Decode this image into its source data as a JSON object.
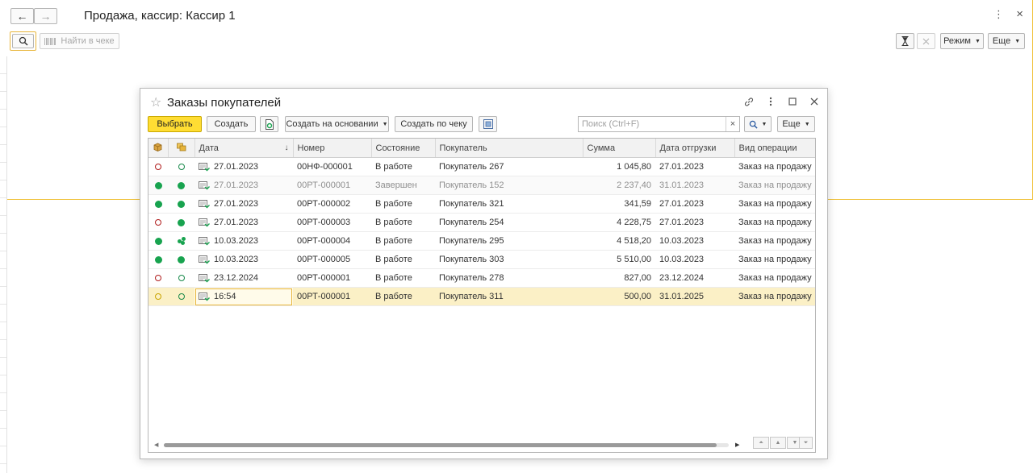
{
  "main": {
    "title": "Продажа, кассир: Кассир 1",
    "back_glyph": "←",
    "forward_glyph": "→",
    "find_in_receipt_label": "Найти в чеке",
    "mode_label": "Режим",
    "more_label": "Еще",
    "kebab_glyph": "⋮",
    "close_glyph": "×"
  },
  "dialog": {
    "title": "Заказы покупателей",
    "toolbar": {
      "select_label": "Выбрать",
      "create_label": "Создать",
      "create_based_label": "Создать на основании",
      "create_by_receipt_label": "Создать по чеку",
      "search_placeholder": "Поиск (Ctrl+F)",
      "search_clear_glyph": "×",
      "more_label": "Еще"
    },
    "columns": {
      "date": "Дата",
      "number": "Номер",
      "state": "Состояние",
      "customer": "Покупатель",
      "sum": "Сумма",
      "ship_date": "Дата отгрузки",
      "operation": "Вид операции",
      "sort_glyph": "↓"
    },
    "rows": [
      {
        "s1": "red-o",
        "s2": "green-o",
        "date": "27.01.2023",
        "number": "00НФ-000001",
        "state": "В работе",
        "customer": "Покупатель 267",
        "sum": "1 045,80",
        "ship_date": "27.01.2023",
        "operation": "Заказ на продажу",
        "style": ""
      },
      {
        "s1": "green-f",
        "s2": "green-f",
        "date": "27.01.2023",
        "number": "00РТ-000001",
        "state": "Завершен",
        "customer": "Покупатель 152",
        "sum": "2 237,40",
        "ship_date": "31.01.2023",
        "operation": "Заказ на продажу",
        "style": "done"
      },
      {
        "s1": "green-f",
        "s2": "green-f",
        "date": "27.01.2023",
        "number": "00РТ-000002",
        "state": "В работе",
        "customer": "Покупатель 321",
        "sum": "341,59",
        "ship_date": "27.01.2023",
        "operation": "Заказ на продажу",
        "style": ""
      },
      {
        "s1": "red-o",
        "s2": "green-f",
        "date": "27.01.2023",
        "number": "00РТ-000003",
        "state": "В работе",
        "customer": "Покупатель 254",
        "sum": "4 228,75",
        "ship_date": "27.01.2023",
        "operation": "Заказ на продажу",
        "style": ""
      },
      {
        "s1": "green-f",
        "s2": "partial",
        "date": "10.03.2023",
        "number": "00РТ-000004",
        "state": "В работе",
        "customer": "Покупатель 295",
        "sum": "4 518,20",
        "ship_date": "10.03.2023",
        "operation": "Заказ на продажу",
        "style": ""
      },
      {
        "s1": "green-f",
        "s2": "green-f",
        "date": "10.03.2023",
        "number": "00РТ-000005",
        "state": "В работе",
        "customer": "Покупатель 303",
        "sum": "5 510,00",
        "ship_date": "10.03.2023",
        "operation": "Заказ на продажу",
        "style": ""
      },
      {
        "s1": "red-o",
        "s2": "green-o",
        "date": "23.12.2024",
        "number": "00РТ-000001",
        "state": "В работе",
        "customer": "Покупатель 278",
        "sum": "827,00",
        "ship_date": "23.12.2024",
        "operation": "Заказ на продажу",
        "style": ""
      },
      {
        "s1": "yellow-o",
        "s2": "green-o",
        "date": "16:54",
        "number": "00РТ-000001",
        "state": "В работе",
        "customer": "Покупатель 311",
        "sum": "500,00",
        "ship_date": "31.01.2025",
        "operation": "Заказ на продажу",
        "style": "selected"
      }
    ]
  },
  "colors": {
    "accent_yellow": "#ffdd33",
    "focus_orange": "#e8b53a",
    "status_red": "#b01c1c",
    "status_green": "#18a34f",
    "selected_row": "#fbf0c6"
  }
}
